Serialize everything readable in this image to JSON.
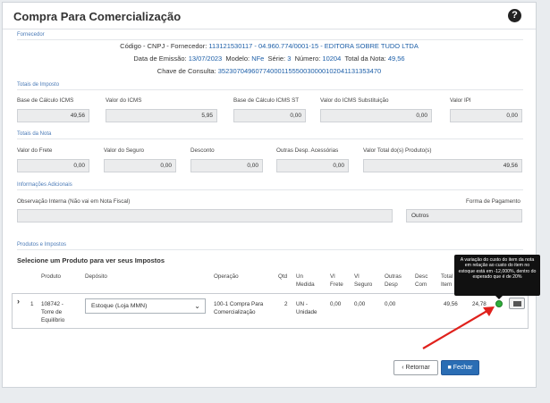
{
  "title": "Compra Para Comercialização",
  "help_icon": "question-circle-icon",
  "supplier": {
    "section": "Fornecedor",
    "code_label": "Código - CNPJ - Fornecedor:",
    "code_value": "113121530117 - 04.960.774/0001-15 - EDITORA SOBRE TUDO LTDA",
    "emissao_label": "Data de Emissão:",
    "emissao_value": "13/07/2023",
    "modelo_label": "Modelo:",
    "modelo_value": "NFe",
    "serie_label": "Série:",
    "serie_value": "3",
    "numero_label": "Número:",
    "numero_value": "10204",
    "total_label": "Total da Nota:",
    "total_value": "49,56",
    "chave_label": "Chave de Consulta:",
    "chave_value": "35230704960774000115550030000102041131353470"
  },
  "impostos": {
    "section": "Totais de Imposto",
    "fields": [
      {
        "label": "Base de Cálculo ICMS",
        "value": "49,56"
      },
      {
        "label": "Valor do ICMS",
        "value": "5,95"
      },
      {
        "label": "Base de Cálculo ICMS ST",
        "value": "0,00"
      },
      {
        "label": "Valor do ICMS Substituição",
        "value": "0,00"
      },
      {
        "label": "Valor IPI",
        "value": "0,00"
      }
    ]
  },
  "nota": {
    "section": "Totais da Nota",
    "fields": [
      {
        "label": "Valor do Frete",
        "value": "0,00"
      },
      {
        "label": "Valor do Seguro",
        "value": "0,00"
      },
      {
        "label": "Desconto",
        "value": "0,00"
      },
      {
        "label": "Outras Desp. Acessórias",
        "value": "0,00"
      },
      {
        "label": "Valor Total do(s) Produto(s)",
        "value": "49,56"
      }
    ]
  },
  "info": {
    "section": "Informações Adicionais",
    "obs_label": "Observação Interna (Não vai em Nota Fiscal)",
    "obs_value": "",
    "pagamento_label": "Forma de Pagamento",
    "pagamento_value": "Outros"
  },
  "produtos": {
    "section": "Produtos e Impostos",
    "heading": "Selecione um Produto para ver seus Impostos",
    "columns": {
      "produto": "Produto",
      "deposito": "Depósito",
      "operacao": "Operação",
      "qtd": "Qtd",
      "un": "Un Medida",
      "vl_frete": "Vl Frete",
      "vl_seguro": "Vl Seguro",
      "outras": "Outras Desp",
      "desc": "Desc Com",
      "total": "Total Item"
    },
    "row": {
      "expand": "›",
      "index": "1",
      "produto": "108742 - Torre de Equilíbrio",
      "deposito": "Estoque (Loja MMN)",
      "operacao": "100-1 Compra Para Comercialização",
      "qtd": "2",
      "un": "UN - Unidade",
      "vl_frete": "0,00",
      "vl_seguro": "0,00",
      "outras": "0,00",
      "total": "49,56",
      "custo": "24,78"
    },
    "tooltip": "A variação do custo do item da nota em relação ao custo do item no estoque está em -12,000%, dentro do esperado que é de 20%"
  },
  "buttons": {
    "back": "‹ Retornar",
    "close": "Fechar"
  },
  "colors": {
    "accent": "#2a6db4",
    "link": "#1d5fa8",
    "ok": "#2fae3b",
    "arrow": "#e0211c"
  }
}
